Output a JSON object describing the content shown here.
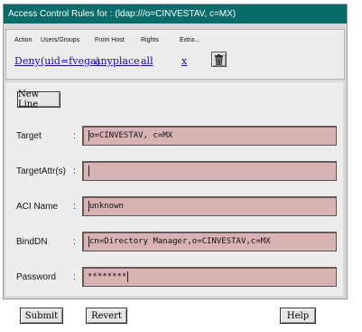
{
  "window": {
    "title": "Access Control Rules for : (ldap:///o=CINVESTAV, c=MX)"
  },
  "rules": {
    "headers": [
      "Action",
      "Users/Groups",
      "From Host",
      "Rights",
      "Extra..."
    ],
    "row": {
      "action": "Deny",
      "users": "(uid=fvega)",
      "host": "anyplace",
      "rights": "all",
      "extra": "x"
    },
    "delete_icon": "trash-can-icon"
  },
  "form": {
    "new_line_label": "New Line",
    "fields": [
      {
        "label": "Target",
        "value": "o=CINVESTAV, c=MX"
      },
      {
        "label": "TargetAttr(s)",
        "value": ""
      },
      {
        "label": "ACI Name",
        "value": "unknown"
      },
      {
        "label": "BindDN",
        "value": "cn=Directory Manager,o=CINVESTAV,c=MX"
      },
      {
        "label": "Password",
        "value": "********"
      }
    ]
  },
  "footer": {
    "submit_label": "Submit",
    "revert_label": "Revert",
    "help_label": "Help"
  },
  "colors": {
    "titlebar": "#0a6b6b",
    "field_bg": "#d9b3b3",
    "link": "#1a0dab"
  }
}
